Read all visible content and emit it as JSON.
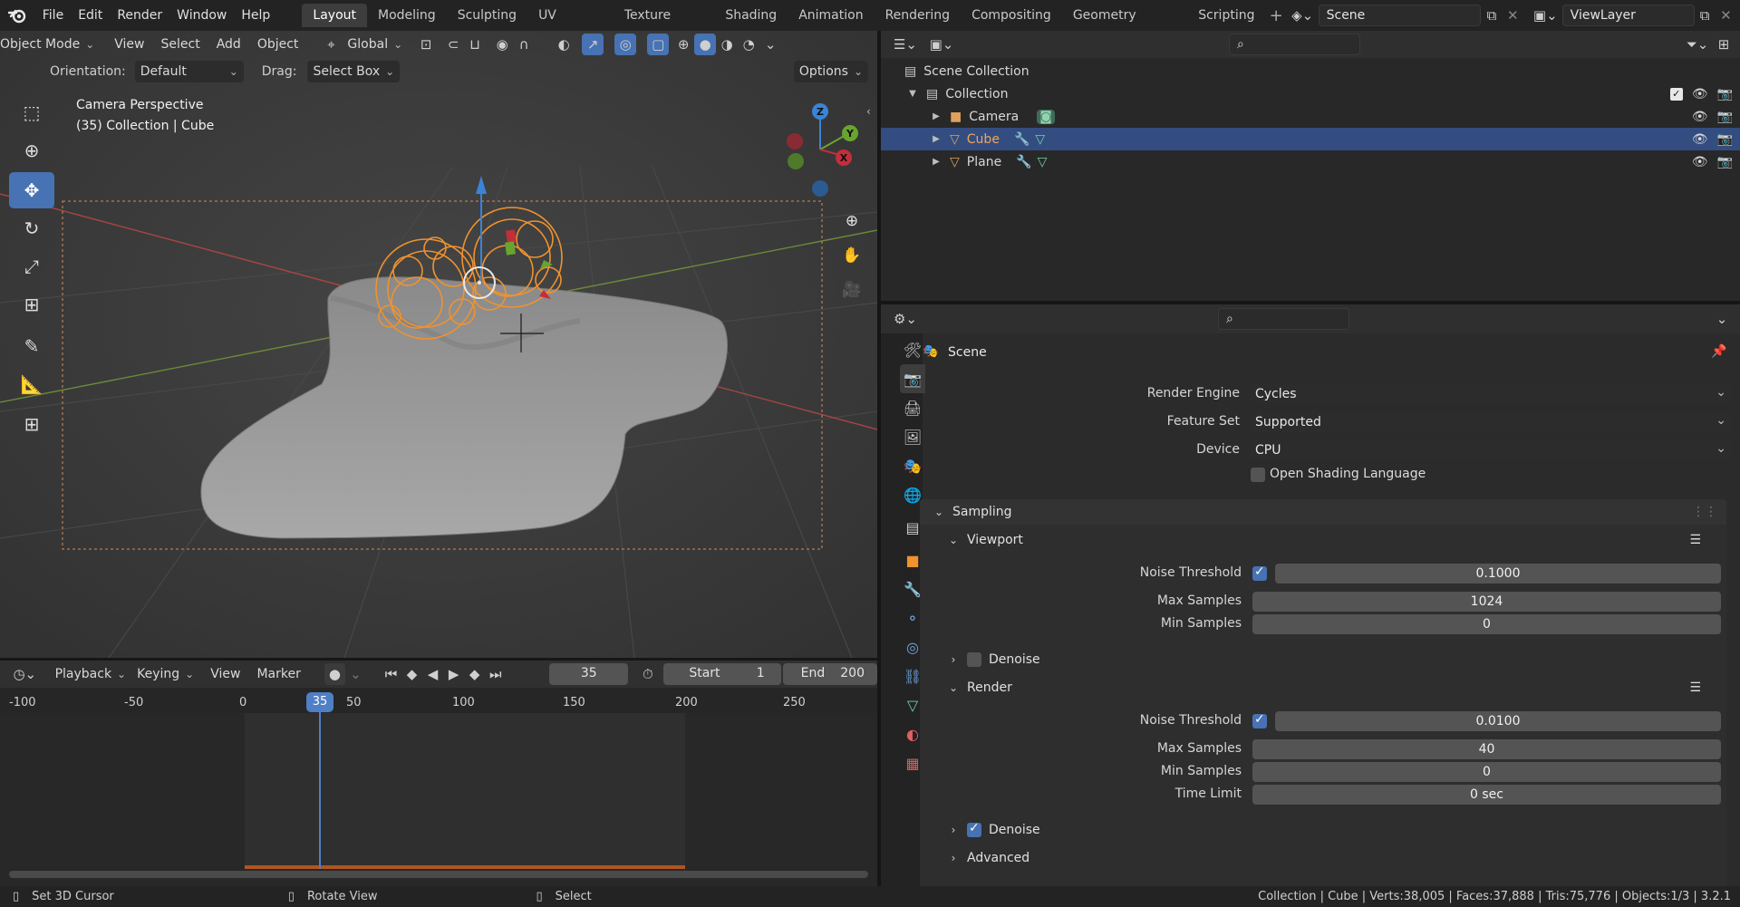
{
  "app": {
    "menus": [
      "File",
      "Edit",
      "Render",
      "Window",
      "Help"
    ]
  },
  "workspaces": [
    "Layout",
    "Modeling",
    "Sculpting",
    "UV Editing",
    "Texture Paint",
    "Shading",
    "Animation",
    "Rendering",
    "Compositing",
    "Geometry Nodes",
    "Scripting"
  ],
  "scene_name": "Scene",
  "view_layer": "ViewLayer",
  "viewport": {
    "mode": "Object Mode",
    "menus": [
      "View",
      "Select",
      "Add",
      "Object"
    ],
    "transform_orientation": "Global",
    "orientation_label": "Orientation:",
    "orientation_value": "Default",
    "drag_label": "Drag:",
    "drag_value": "Select Box",
    "options_label": "Options",
    "overlay_title": "Camera Perspective",
    "overlay_subtitle": "(35) Collection | Cube",
    "gizmo_axes": {
      "x": "X",
      "y": "Y",
      "z": "Z"
    }
  },
  "outliner": {
    "root": "Scene Collection",
    "collection": "Collection",
    "items": [
      {
        "name": "Camera"
      },
      {
        "name": "Cube"
      },
      {
        "name": "Plane"
      }
    ]
  },
  "properties": {
    "context": "Scene",
    "render_engine_label": "Render Engine",
    "render_engine": "Cycles",
    "feature_set_label": "Feature Set",
    "feature_set": "Supported",
    "device_label": "Device",
    "device": "CPU",
    "osl_label": "Open Shading Language",
    "sampling_label": "Sampling",
    "viewport_label": "Viewport",
    "noise_threshold_label": "Noise Threshold",
    "viewport_noise": "0.1000",
    "max_samples_label": "Max Samples",
    "viewport_max": "1024",
    "min_samples_label": "Min Samples",
    "viewport_min": "0",
    "denoise_label": "Denoise",
    "render_label": "Render",
    "render_noise": "0.0100",
    "render_max": "40",
    "render_min": "0",
    "time_limit_label": "Time Limit",
    "time_limit": "0 sec",
    "advanced_label": "Advanced"
  },
  "timeline": {
    "menus": {
      "playback": "Playback",
      "keying": "Keying",
      "view": "View",
      "marker": "Marker"
    },
    "current_frame": "35",
    "start_label": "Start",
    "start": "1",
    "end_label": "End",
    "end": "200",
    "ticks": [
      "-100",
      "-50",
      "0",
      "50",
      "100",
      "150",
      "200",
      "250"
    ]
  },
  "statusbar": {
    "left": "Set 3D Cursor",
    "middle": "Rotate View",
    "right": "Select",
    "stats": "Collection | Cube | Verts:38,005 | Faces:37,888 | Tris:75,776 | Objects:1/3 | 3.2.1"
  }
}
